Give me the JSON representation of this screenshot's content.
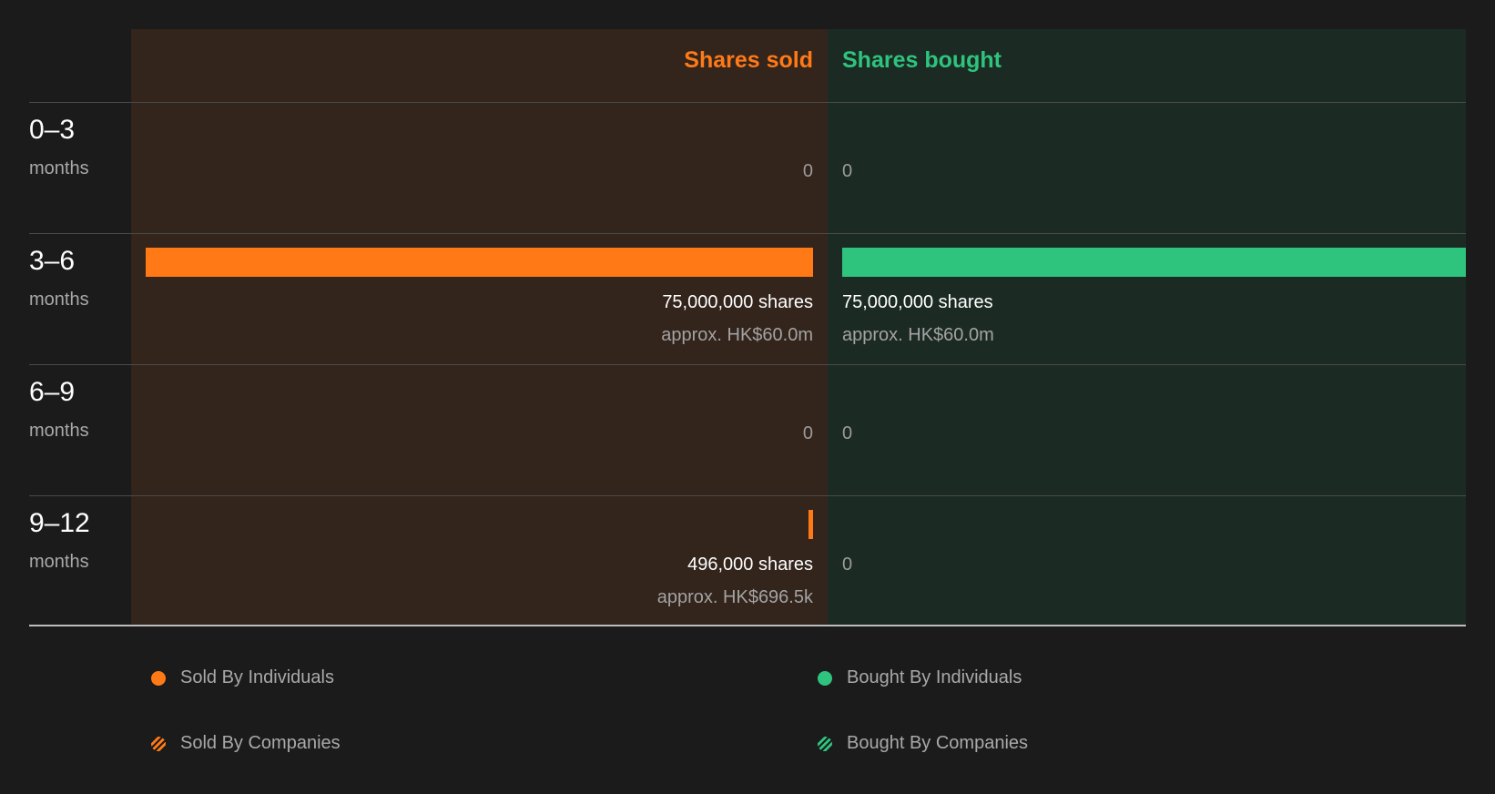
{
  "colors": {
    "sold": "#ff7a17",
    "bought": "#2ec47d",
    "sold_panel": "#33241c",
    "bought_panel": "#1c2a24"
  },
  "chart_data": {
    "type": "bar",
    "orientation": "horizontal-diverging",
    "column_headers": {
      "sold": "Shares sold",
      "bought": "Shares bought"
    },
    "categories": [
      {
        "range": "0–3",
        "unit": "months"
      },
      {
        "range": "3–6",
        "unit": "months"
      },
      {
        "range": "6–9",
        "unit": "months"
      },
      {
        "range": "9–12",
        "unit": "months"
      }
    ],
    "series": [
      {
        "name": "Shares sold",
        "side": "sold",
        "values": [
          0,
          75000000,
          0,
          496000
        ],
        "value_labels": [
          "0",
          "75,000,000 shares",
          "0",
          "496,000 shares"
        ],
        "approx_labels": [
          "",
          "approx. HK$60.0m",
          "",
          "approx. HK$696.5k"
        ]
      },
      {
        "name": "Shares bought",
        "side": "bought",
        "values": [
          0,
          75000000,
          0,
          0
        ],
        "value_labels": [
          "0",
          "75,000,000 shares",
          "0",
          "0"
        ],
        "approx_labels": [
          "",
          "approx. HK$60.0m",
          "",
          ""
        ]
      }
    ],
    "xlim": [
      0,
      75000000
    ],
    "legend": {
      "placement": "bottom",
      "items": [
        {
          "label": "Sold By Individuals",
          "color": "#ff7a17",
          "style": "solid"
        },
        {
          "label": "Bought By Individuals",
          "color": "#2ec47d",
          "style": "solid"
        },
        {
          "label": "Sold By Companies",
          "color": "#ff7a17",
          "style": "hatched"
        },
        {
          "label": "Bought By Companies",
          "color": "#2ec47d",
          "style": "hatched"
        }
      ]
    }
  }
}
